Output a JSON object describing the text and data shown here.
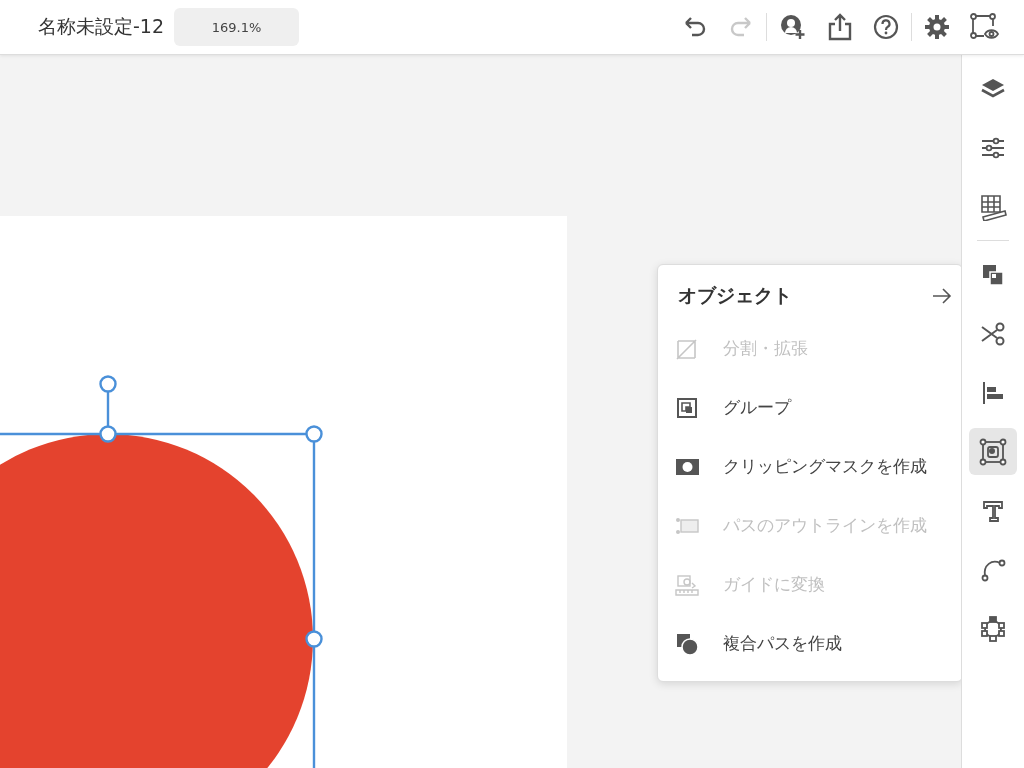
{
  "document": {
    "title": "名称未設定-12",
    "zoom": "169.1%"
  },
  "toolbar": [
    {
      "kind": "undo",
      "disabled": false
    },
    {
      "kind": "redo",
      "disabled": true
    },
    {
      "kind": "invite",
      "disabled": false
    },
    {
      "kind": "share",
      "disabled": false
    },
    {
      "kind": "help",
      "disabled": false
    },
    {
      "kind": "settings",
      "disabled": false
    },
    {
      "kind": "preview",
      "disabled": false
    }
  ],
  "side_tools": [
    {
      "kind": "layers",
      "selected": false
    },
    {
      "kind": "properties",
      "selected": false
    },
    {
      "kind": "grid",
      "selected": false
    },
    {
      "kind": "arrange",
      "selected": false
    },
    {
      "kind": "cut",
      "selected": false
    },
    {
      "kind": "align",
      "selected": false
    },
    {
      "kind": "object",
      "selected": true
    },
    {
      "kind": "text",
      "selected": false
    },
    {
      "kind": "path",
      "selected": false
    },
    {
      "kind": "symbol",
      "selected": false
    }
  ],
  "menu": {
    "title": "オブジェクト",
    "items": [
      {
        "kind": "expand",
        "label": "分割・拡張",
        "disabled": true
      },
      {
        "kind": "group",
        "label": "グループ",
        "disabled": false
      },
      {
        "kind": "mask",
        "label": "クリッピングマスクを作成",
        "disabled": false
      },
      {
        "kind": "outline",
        "label": "パスのアウトラインを作成",
        "disabled": true
      },
      {
        "kind": "guide",
        "label": "ガイドに変換",
        "disabled": true
      },
      {
        "kind": "compound",
        "label": "複合パスを作成",
        "disabled": false
      }
    ]
  }
}
